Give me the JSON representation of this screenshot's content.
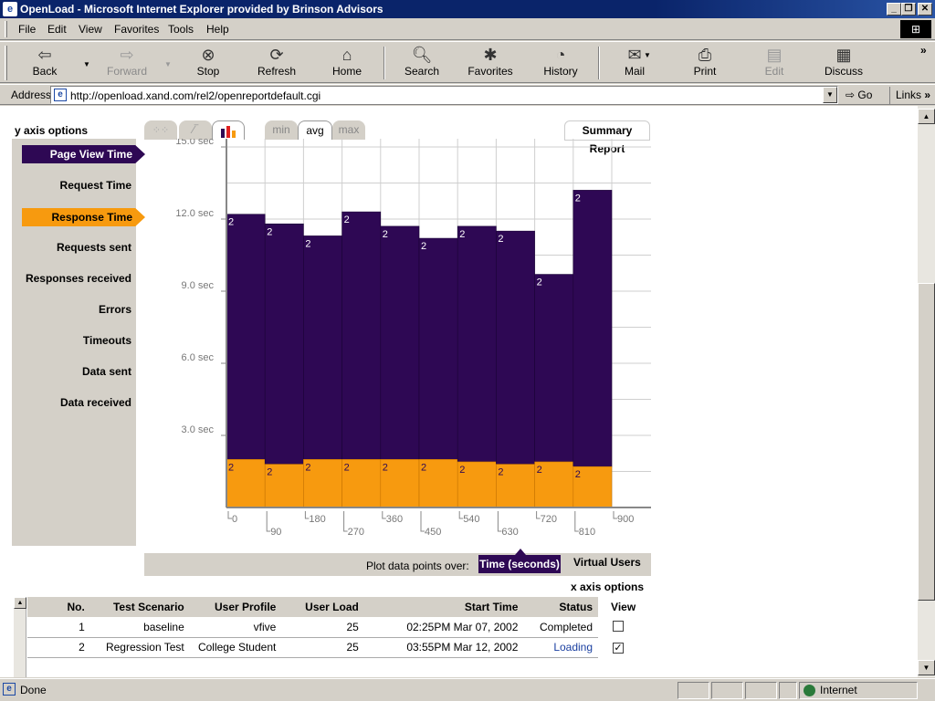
{
  "window": {
    "title": "OpenLoad - Microsoft Internet Explorer provided by Brinson Advisors"
  },
  "menu": [
    "File",
    "Edit",
    "View",
    "Favorites",
    "Tools",
    "Help"
  ],
  "toolbar": {
    "back": "Back",
    "forward": "Forward",
    "stop": "Stop",
    "refresh": "Refresh",
    "home": "Home",
    "search": "Search",
    "favorites": "Favorites",
    "history": "History",
    "mail": "Mail",
    "print": "Print",
    "edit": "Edit",
    "discuss": "Discuss"
  },
  "address": {
    "label": "Address",
    "url": "http://openload.xand.com/rel2/openreportdefault.cgi",
    "go": "Go",
    "links": "Links"
  },
  "y_axis_options": {
    "title": "y axis options",
    "items": [
      "Page View Time",
      "Request Time",
      "Response Time",
      "Requests sent",
      "Responses received",
      "Errors",
      "Timeouts",
      "Data sent",
      "Data received"
    ]
  },
  "tabs": {
    "min": "min",
    "avg": "avg",
    "max": "max",
    "active": "avg"
  },
  "summary_report": "Summary Report",
  "chart_data": {
    "type": "bar",
    "stacked": true,
    "x_ticks": [
      "0",
      "90",
      "180",
      "270",
      "360",
      "450",
      "540",
      "630",
      "720",
      "810",
      "900"
    ],
    "y_ticks": [
      "15.0 sec",
      "12.0 sec",
      "9.0 sec",
      "6.0 sec",
      "3.0 sec"
    ],
    "ylim": [
      0,
      15
    ],
    "bins_start": [
      0,
      90,
      180,
      270,
      360,
      450,
      540,
      630,
      720,
      810
    ],
    "series": [
      {
        "name": "Response Time",
        "color": "#f79a0f",
        "values": [
          2.0,
          1.8,
          2.0,
          2.0,
          2.0,
          2.0,
          1.9,
          1.8,
          1.9,
          1.7
        ]
      },
      {
        "name": "Page View Time",
        "color": "#2e0854",
        "values": [
          12.2,
          11.8,
          11.3,
          12.3,
          11.7,
          11.2,
          11.7,
          11.5,
          9.7,
          13.2
        ]
      }
    ],
    "data_labels": [
      "2",
      "2",
      "2",
      "2",
      "2",
      "2",
      "2",
      "2",
      "2",
      "2"
    ]
  },
  "plot_over": {
    "label": "Plot data points over:",
    "time": "Time (seconds)",
    "virtual_users": "Virtual Users"
  },
  "x_axis_options": "x axis options",
  "table": {
    "headers": [
      "No.",
      "Test Scenario",
      "User Profile",
      "User Load",
      "Start Time",
      "Status",
      "View"
    ],
    "rows": [
      {
        "no": "1",
        "scenario": "baseline",
        "profile": "vfive",
        "load": "25",
        "start": "02:25PM Mar 07, 2002",
        "status": "Completed",
        "checked": false
      },
      {
        "no": "2",
        "scenario": "Regression Test",
        "profile": "College Student",
        "load": "25",
        "start": "03:55PM Mar 12, 2002",
        "status": "Loading",
        "checked": true
      }
    ]
  },
  "status": {
    "text": "Done",
    "zone": "Internet"
  }
}
